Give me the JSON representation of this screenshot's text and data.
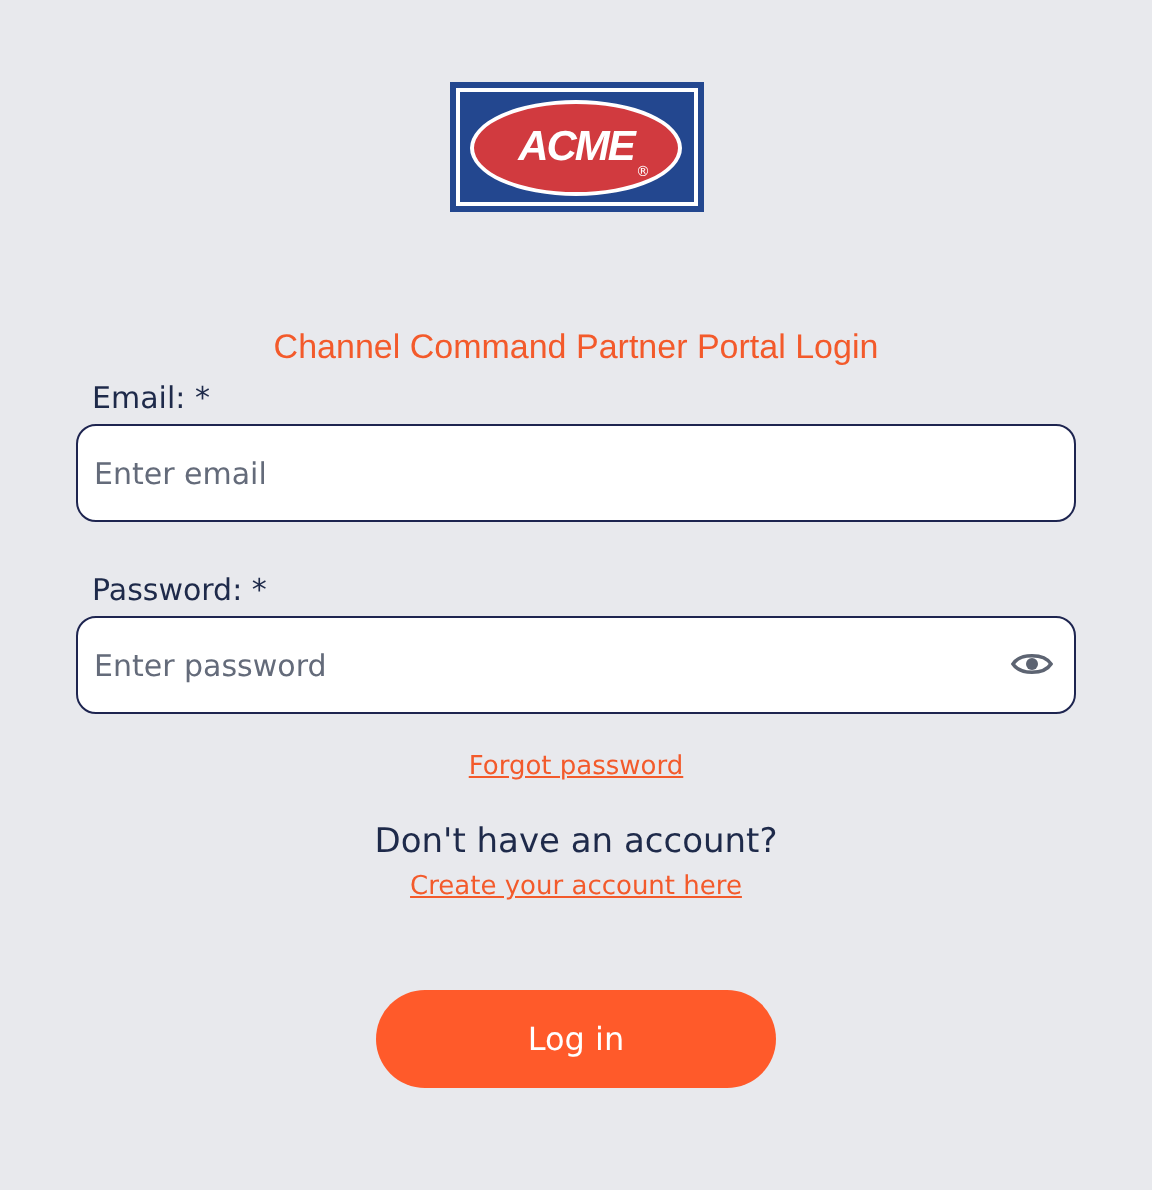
{
  "logo": {
    "text": "ACME",
    "mark": "®"
  },
  "title": "Channel Command Partner Portal Login",
  "fields": [
    {
      "kind": "email",
      "label": "Email: *",
      "placeholder": "Enter email"
    },
    {
      "kind": "password",
      "label": "Password: *",
      "placeholder": "Enter password"
    }
  ],
  "forgot_link": "Forgot password",
  "signup_prompt": "Don't have an account?",
  "signup_link": "Create your account here",
  "login_button": "Log in"
}
